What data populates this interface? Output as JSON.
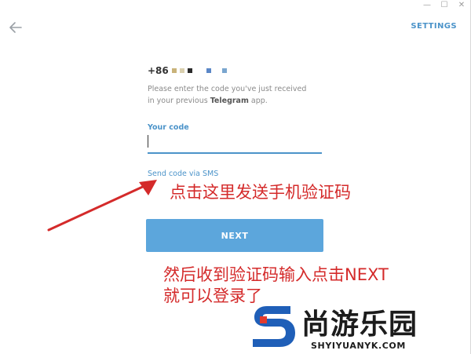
{
  "window": {
    "minimize_glyph": "—",
    "maximize_glyph": "☐",
    "close_glyph": "✕"
  },
  "header": {
    "back_icon": "back-arrow-icon",
    "settings_label": "SETTINGS"
  },
  "phone": {
    "prefix": "+86",
    "mask_colors": [
      "#c9b37a",
      "#d9cfae",
      "#2b2b2b",
      "#5b87c7",
      "#7aa6cf"
    ]
  },
  "hint": {
    "line1": "Please enter the code you've just received",
    "line2_pre": "in your previous ",
    "line2_bold": "Telegram",
    "line2_post": " app."
  },
  "code": {
    "label": "Your code",
    "value": ""
  },
  "sms_link": "Send code via SMS",
  "next_label": "NEXT",
  "annotations": {
    "tip1": "点击这里发送手机验证码",
    "tip2_line1": "然后收到验证码输入点击NEXT",
    "tip2_line2": "就可以登录了"
  },
  "watermark": {
    "title": "尚游乐园",
    "url": "SHYIYUANYK.COM"
  },
  "colors": {
    "accent": "#4b93c9",
    "button": "#5ca6dc",
    "annotation": "#d42a2a"
  }
}
